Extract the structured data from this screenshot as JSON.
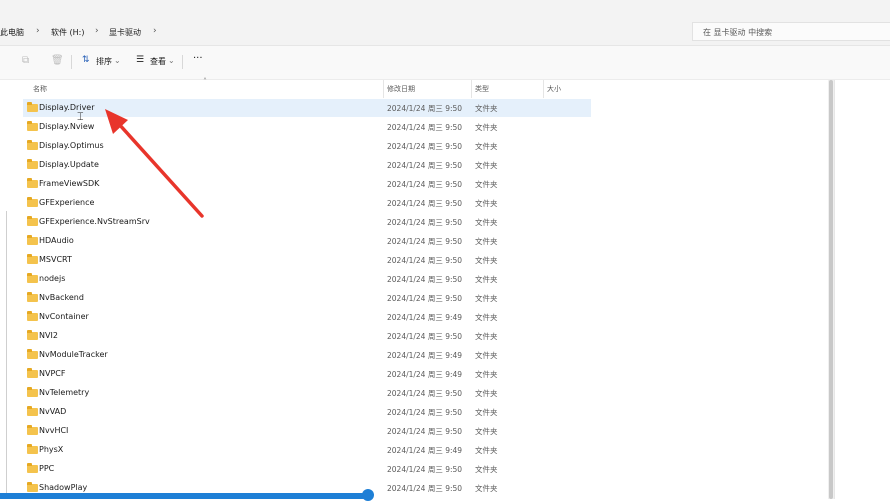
{
  "address": {
    "breadcrumbs": [
      "此电脑",
      "软件 (H:)",
      "显卡驱动"
    ],
    "search_placeholder": "在 显卡驱动 中搜索"
  },
  "toolbar": {
    "sort_label": "排序",
    "view_label": "查看",
    "more_label": "···"
  },
  "columns": {
    "name": "名称",
    "date": "修改日期",
    "type": "类型",
    "size": "大小"
  },
  "files": [
    {
      "name": "Display.Driver",
      "date": "2024/1/24 周三 9:50",
      "type": "文件夹",
      "selected": true
    },
    {
      "name": "Display.Nview",
      "date": "2024/1/24 周三 9:50",
      "type": "文件夹"
    },
    {
      "name": "Display.Optimus",
      "date": "2024/1/24 周三 9:50",
      "type": "文件夹"
    },
    {
      "name": "Display.Update",
      "date": "2024/1/24 周三 9:50",
      "type": "文件夹"
    },
    {
      "name": "FrameViewSDK",
      "date": "2024/1/24 周三 9:50",
      "type": "文件夹"
    },
    {
      "name": "GFExperience",
      "date": "2024/1/24 周三 9:50",
      "type": "文件夹"
    },
    {
      "name": "GFExperience.NvStreamSrv",
      "date": "2024/1/24 周三 9:50",
      "type": "文件夹"
    },
    {
      "name": "HDAudio",
      "date": "2024/1/24 周三 9:50",
      "type": "文件夹"
    },
    {
      "name": "MSVCRT",
      "date": "2024/1/24 周三 9:50",
      "type": "文件夹"
    },
    {
      "name": "nodejs",
      "date": "2024/1/24 周三 9:50",
      "type": "文件夹"
    },
    {
      "name": "NvBackend",
      "date": "2024/1/24 周三 9:50",
      "type": "文件夹"
    },
    {
      "name": "NvContainer",
      "date": "2024/1/24 周三 9:49",
      "type": "文件夹"
    },
    {
      "name": "NVI2",
      "date": "2024/1/24 周三 9:50",
      "type": "文件夹"
    },
    {
      "name": "NvModuleTracker",
      "date": "2024/1/24 周三 9:49",
      "type": "文件夹"
    },
    {
      "name": "NVPCF",
      "date": "2024/1/24 周三 9:49",
      "type": "文件夹"
    },
    {
      "name": "NvTelemetry",
      "date": "2024/1/24 周三 9:50",
      "type": "文件夹"
    },
    {
      "name": "NvVAD",
      "date": "2024/1/24 周三 9:50",
      "type": "文件夹"
    },
    {
      "name": "NvvHCI",
      "date": "2024/1/24 周三 9:50",
      "type": "文件夹"
    },
    {
      "name": "PhysX",
      "date": "2024/1/24 周三 9:49",
      "type": "文件夹"
    },
    {
      "name": "PPC",
      "date": "2024/1/24 周三 9:50",
      "type": "文件夹"
    },
    {
      "name": "ShadowPlay",
      "date": "2024/1/24 周三 9:50",
      "type": "文件夹"
    }
  ],
  "colors": {
    "annotation_arrow": "#e8352b",
    "selection": "#e5f0fb",
    "folder": "#f4c34d",
    "accent": "#1e7fd6"
  }
}
